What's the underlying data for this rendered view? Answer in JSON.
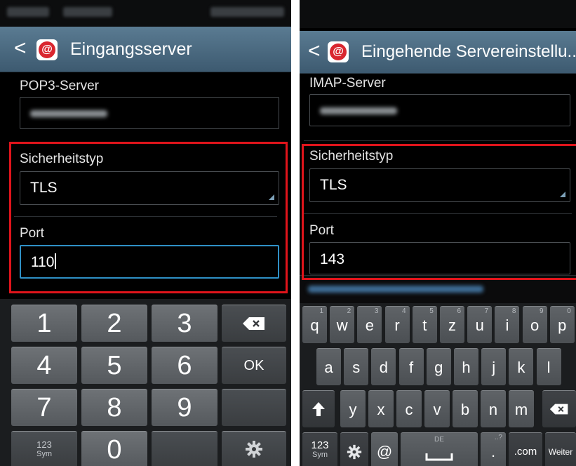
{
  "left_phone": {
    "title": "Eingangsserver",
    "back_glyph": "<",
    "server_label": "POP3-Server",
    "security_label": "Sicherheitstyp",
    "security_value": "TLS",
    "port_label": "Port",
    "port_value": "110",
    "keypad": {
      "keys": [
        "1",
        "2",
        "3",
        "4",
        "5",
        "6",
        "7",
        "8",
        "9",
        "0"
      ],
      "sym_top": "123",
      "sym_bottom": "Sym",
      "ok_label": "OK",
      "backspace_icon": "backspace-icon",
      "settings_icon": "gear-icon"
    }
  },
  "right_phone": {
    "title": "Eingehende Servereinstellu..",
    "back_glyph": "<",
    "server_label": "IMAP-Server",
    "security_label": "Sicherheitstyp",
    "security_value": "TLS",
    "port_label": "Port",
    "port_value": "143",
    "keyboard": {
      "row1": [
        {
          "ch": "q",
          "sup": "1"
        },
        {
          "ch": "w",
          "sup": "2"
        },
        {
          "ch": "e",
          "sup": "3"
        },
        {
          "ch": "r",
          "sup": "4"
        },
        {
          "ch": "t",
          "sup": "5"
        },
        {
          "ch": "z",
          "sup": "6"
        },
        {
          "ch": "u",
          "sup": "7"
        },
        {
          "ch": "i",
          "sup": "8"
        },
        {
          "ch": "o",
          "sup": "9"
        },
        {
          "ch": "p",
          "sup": "0"
        }
      ],
      "row2": [
        "a",
        "s",
        "d",
        "f",
        "g",
        "h",
        "j",
        "k",
        "l"
      ],
      "row3": [
        "y",
        "x",
        "c",
        "v",
        "b",
        "n",
        "m"
      ],
      "sym_top": "123",
      "sym_bottom": "Sym",
      "at_label": "@",
      "space_label": "DE",
      "dot_label": ".",
      "dot_sup": "..?",
      "com_label": ".com",
      "next_label": "Weiter",
      "shift_icon": "shift-arrow-icon",
      "backspace_icon": "backspace-icon",
      "settings_icon": "gear-icon",
      "space_icon": "spacebar-icon"
    }
  },
  "colors": {
    "highlight": "#e0141b",
    "focus": "#2f90c6",
    "actionbar": "#4b6a80",
    "app_icon": "#d9262f"
  }
}
